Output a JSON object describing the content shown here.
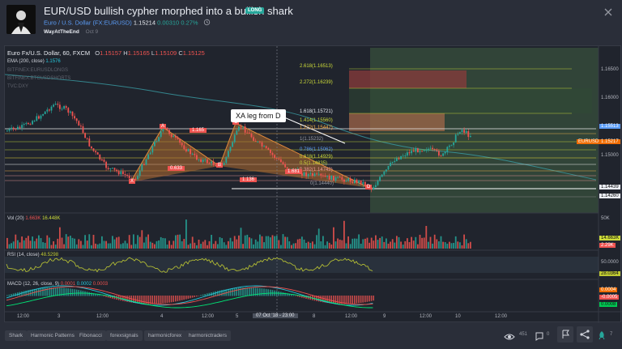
{
  "header": {
    "title": "EUR/USD bullish cypher morphed into a bullish shark",
    "badge": "LONG",
    "symbol_name": "Euro / U.S. Dollar",
    "symbol_ticker": "(FX:EURUSD)",
    "price": "1.15214",
    "change": "0.00310",
    "change_pct": "0.27%",
    "author": "WayAtTheEnd",
    "date": "Oct 9"
  },
  "chart": {
    "symbol_header": "Euro Fx/U.S. Dollar, 60, FXCM",
    "ohlc": {
      "o_label": "O",
      "o": "1.15157",
      "h_label": "H",
      "h": "1.15165",
      "l_label": "L",
      "l": "1.15109",
      "c_label": "C",
      "c": "1.15125"
    },
    "ema_label": "EMA (200, close)",
    "ema_value": "1.1576",
    "overlays": [
      "BITFINEX:EURUSDLONGS",
      "BITFINEX:BTCUSDSHORTS",
      "TVC:DXY"
    ],
    "price_axis": [
      "1.16500",
      "1.16000",
      "1.15000"
    ],
    "price_tags": {
      "current": "1.15513",
      "eurusd_label": "EURUSD",
      "eurusd": "1.15217",
      "low1": "1.14439",
      "low2": "1.14260"
    },
    "fib_levels": [
      "2.618(1.16513)",
      "2.272(1.16239)",
      "1.618(1.15721)",
      "1.414(1.15560)",
      "1.272(1.15447)",
      "1(1.15232)",
      "0.786(1.15062)",
      "0.618(1.14929)",
      "0.5(1.14835)",
      "0.382(1.14742)",
      "0(1.14440)"
    ],
    "pattern_labels": {
      "x": "X",
      "a": "A",
      "b": "B",
      "c": "C",
      "d": "D",
      "xa_ratio": "1.165",
      "ab_ratio": "0.633",
      "bc_ratio": "1.136",
      "cd_ratio": "1.681"
    },
    "callout": "XA leg from D",
    "volume_label": "Vol (20)",
    "volume_values": [
      "1.663K",
      "16.448K"
    ],
    "volume_axis": [
      "50K",
      "14.663K",
      "2.29K"
    ],
    "rsi_label": "RSI (14, close)",
    "rsi_value": "48.5298",
    "rsi_axis": [
      "50.0000",
      "28.0364"
    ],
    "macd_label": "MACD (12, 26, close, 9)",
    "macd_values": [
      "0.0001",
      "0.0002",
      "0.0003"
    ],
    "macd_axis": [
      "0.0004",
      "-0.0005",
      "0.0008"
    ],
    "time_axis": [
      "12:00",
      "3",
      "12:00",
      "4",
      "12:00",
      "5",
      "12:00",
      "8",
      "12:00",
      "9",
      "12:00",
      "10",
      "12:00"
    ],
    "crosshair_time": "07 Oct '18 - 23:00"
  },
  "footer": {
    "tags": [
      "Shark",
      "Harmonic Patterns",
      "Fibonacci",
      "forexsignals",
      "harmonicforex",
      "harmonictraders"
    ],
    "views": "451",
    "comments": "0",
    "likes": "7"
  },
  "colors": {
    "bull": "#26a69a",
    "bear": "#ef5350",
    "accent": "#5b9cf6",
    "bg": "#20242d"
  }
}
